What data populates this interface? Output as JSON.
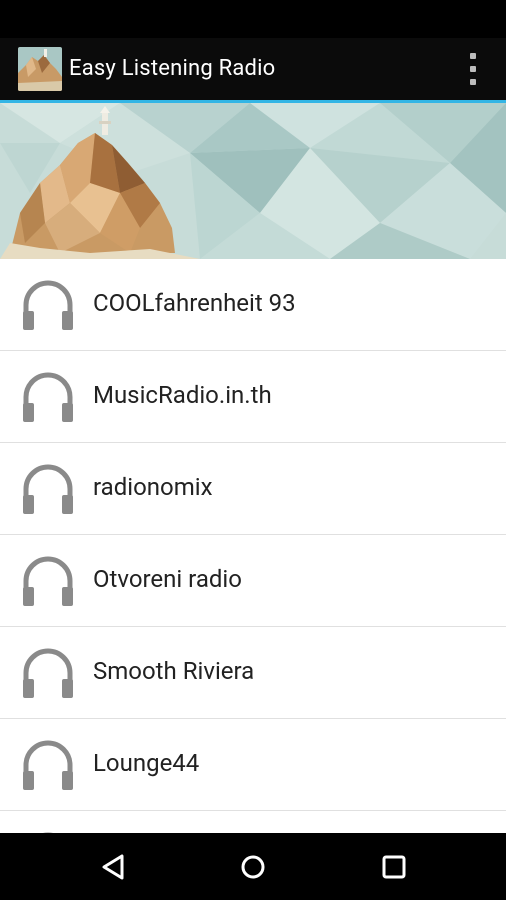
{
  "app": {
    "title": "Easy Listening Radio"
  },
  "stations": [
    {
      "name": "COOLfahrenheit 93"
    },
    {
      "name": "MusicRadio.in.th"
    },
    {
      "name": "radionomix"
    },
    {
      "name": "Otvoreni radio"
    },
    {
      "name": "Smooth Riviera"
    },
    {
      "name": "Lounge44"
    },
    {
      "name": ""
    }
  ],
  "icons": {
    "station": "headphones-icon",
    "overflow": "overflow-menu-icon",
    "nav_back": "back-icon",
    "nav_home": "home-icon",
    "nav_recents": "recents-icon"
  },
  "colors": {
    "action_bar": "#0b0b0b",
    "accent": "#33b5e5",
    "icon_gray": "#8a8a8a"
  }
}
